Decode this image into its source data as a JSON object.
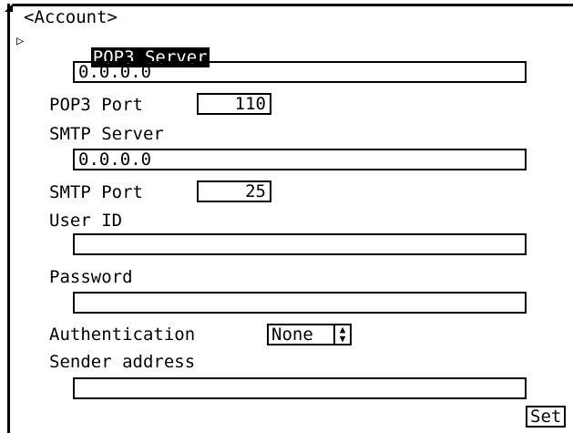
{
  "title": "<Account>",
  "pop3_server": {
    "label": "POP3 Server",
    "value": "0.0.0.0"
  },
  "pop3_port": {
    "label": "POP3 Port",
    "value": "110"
  },
  "smtp_server": {
    "label": "SMTP Server",
    "value": "0.0.0.0"
  },
  "smtp_port": {
    "label": "SMTP Port",
    "value": "25"
  },
  "user_id": {
    "label": "User ID",
    "value": ""
  },
  "password": {
    "label": "Password",
    "value": ""
  },
  "authentication": {
    "label": "Authentication",
    "value": "None"
  },
  "sender_address": {
    "label": "Sender address",
    "value": ""
  },
  "set_button": "Set",
  "icons": {
    "cursor": "triangle-right-icon",
    "spinner": "up-down-arrows-icon"
  }
}
